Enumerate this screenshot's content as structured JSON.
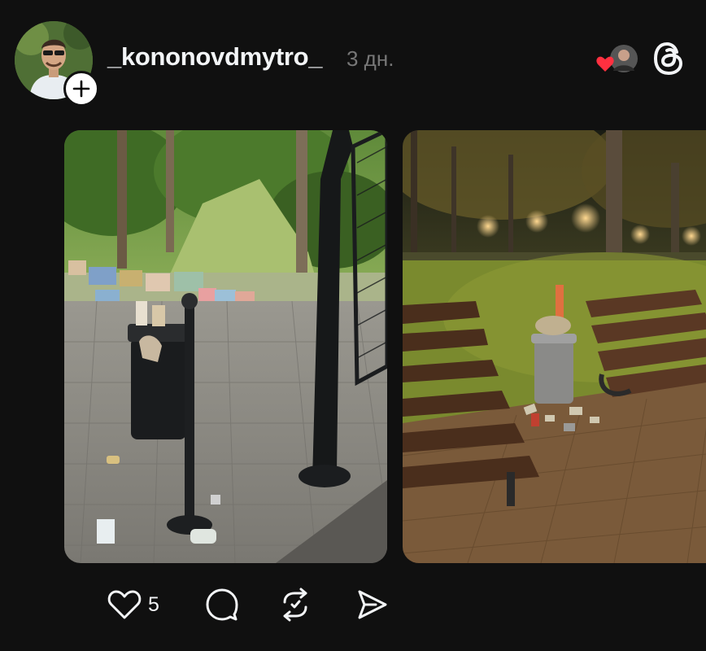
{
  "post": {
    "author": {
      "username": "_kononovdmytro_",
      "age": "3 дн.",
      "avatar_icon": "profile-photo"
    },
    "header_icons": {
      "follow": "plus-icon",
      "liker": "heart-badge-icon",
      "app": "threads-logo-icon"
    },
    "media": [
      {
        "icon": "photo-park-daytime-overflowing-trash-bin"
      },
      {
        "icon": "photo-park-night-overflowing-trash-bin"
      }
    ],
    "actions": {
      "likes": "5",
      "like_icon": "heart-icon",
      "comment_icon": "comment-icon",
      "repost_icon": "repost-icon",
      "share_icon": "send-icon"
    }
  },
  "colors": {
    "background": "#101010",
    "text": "#f3f5f7",
    "muted": "#777777",
    "heart": "#ff3040"
  }
}
